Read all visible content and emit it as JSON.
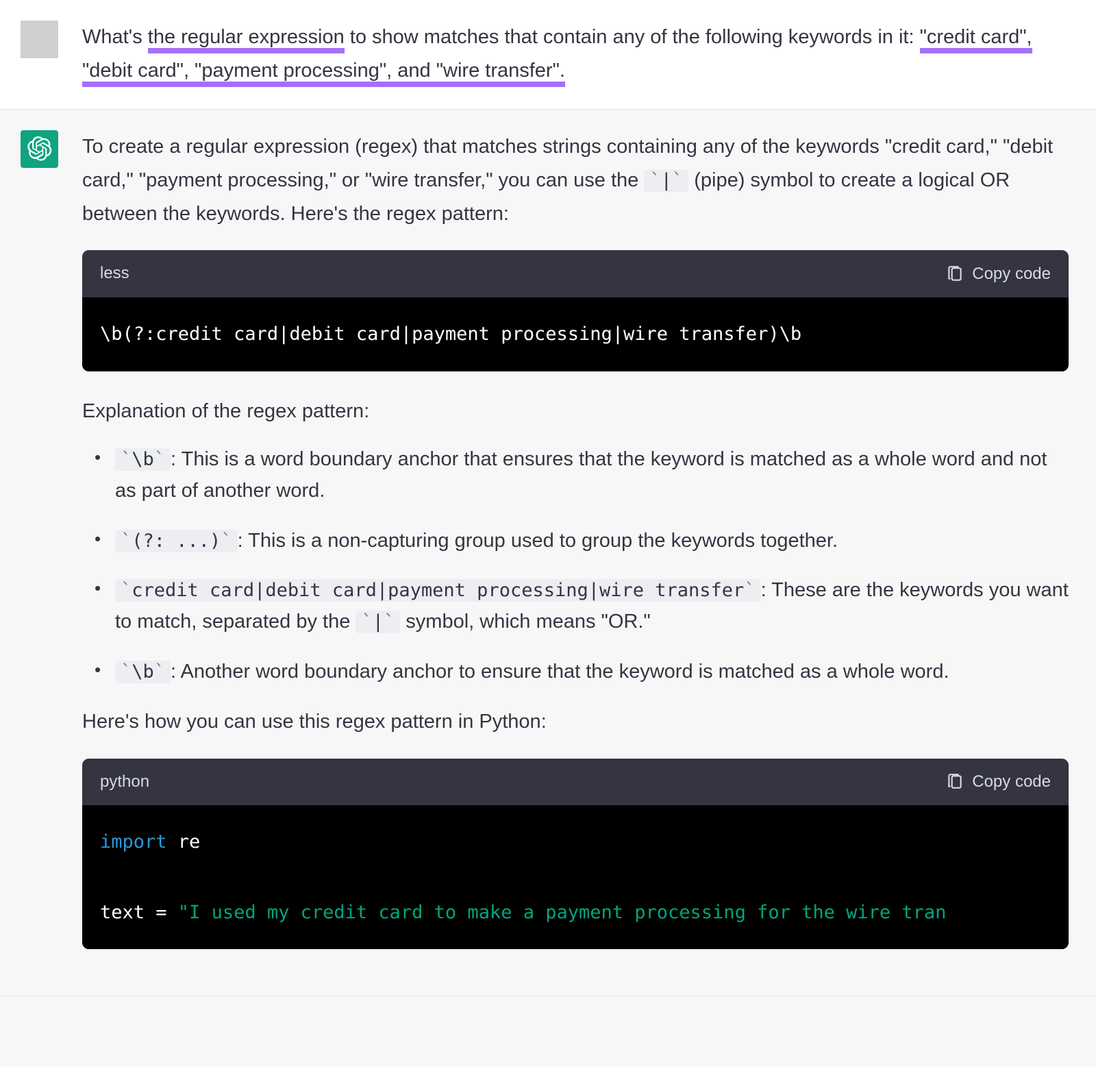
{
  "user": {
    "q_parts": {
      "p1": "What's ",
      "u1": "the regular expression",
      "p2": " to show matches that contain any of the following keywords in it: ",
      "u2": "\"credit card\", \"debit card\", \"payment processing\", and \"wire transfer\".",
      "p3": ""
    }
  },
  "assistant": {
    "intro_p1a": "To create a regular expression (regex) that matches strings containing any of the keywords \"credit card,\" \"debit card,\" \"payment processing,\" or \"wire transfer,\" you can use the ",
    "intro_pipe": "|",
    "intro_p1b": " (pipe) symbol to create a logical OR between the keywords. Here's the regex pattern:",
    "code1": {
      "lang": "less",
      "copy": "Copy code",
      "content": "\\b(?:credit card|debit card|payment processing|wire transfer)\\b"
    },
    "explain_title": "Explanation of the regex pattern:",
    "bullets": [
      {
        "code": "\\b",
        "text": ": This is a word boundary anchor that ensures that the keyword is matched as a whole word and not as part of another word."
      },
      {
        "code": "(?: ...)",
        "text": ": This is a non-capturing group used to group the keywords together."
      },
      {
        "code": "credit card|debit card|payment processing|wire transfer",
        "text_a": ": These are the keywords you want to match, separated by the ",
        "pipe": "|",
        "text_b": " symbol, which means \"OR.\""
      },
      {
        "code": "\\b",
        "text": ": Another word boundary anchor to ensure that the keyword is matched as a whole word."
      }
    ],
    "usage_line": "Here's how you can use this regex pattern in Python:",
    "code2": {
      "lang": "python",
      "copy": "Copy code",
      "kw_import": "import",
      "mod_re": " re",
      "var_text": "text = ",
      "str_text": "\"I used my credit card to make a payment processing for the wire tran"
    }
  }
}
